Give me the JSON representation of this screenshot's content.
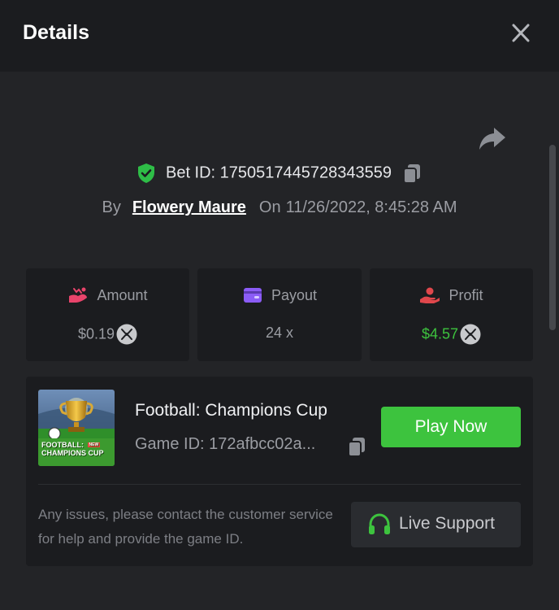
{
  "header": {
    "title": "Details",
    "close_icon": "close-icon"
  },
  "share_icon": "share-icon",
  "bet": {
    "id_label": "Bet ID: 1750517445728343559",
    "by_label": "By",
    "user": "Flowery Maure",
    "on_label": "On",
    "date": "11/26/2022, 8:45:28 AM"
  },
  "stats": {
    "amount": {
      "label": "Amount",
      "value": "$0.19",
      "icon": "money-bag-icon"
    },
    "payout": {
      "label": "Payout",
      "value": "24 x",
      "icon": "wallet-icon"
    },
    "profit": {
      "label": "Profit",
      "value": "$4.57",
      "icon": "profit-hand-icon"
    }
  },
  "game": {
    "name": "Football: Champions Cup",
    "id_label": "Game ID: 172afbcc02a...",
    "thumb_title_line1": "FOOTBALL:",
    "thumb_title_line2": "CHAMPIONS CUP",
    "thumb_badge": "NEW",
    "play_label": "Play Now"
  },
  "support": {
    "text": "Any issues, please contact the customer service for help and provide the game ID.",
    "button_label": "Live Support"
  },
  "colors": {
    "accent_green": "#3dc33e",
    "shield_green": "#2ebd47",
    "amount_icon": "#e9446b",
    "payout_icon": "#8b5cf6",
    "profit_icon": "#e0474c"
  }
}
